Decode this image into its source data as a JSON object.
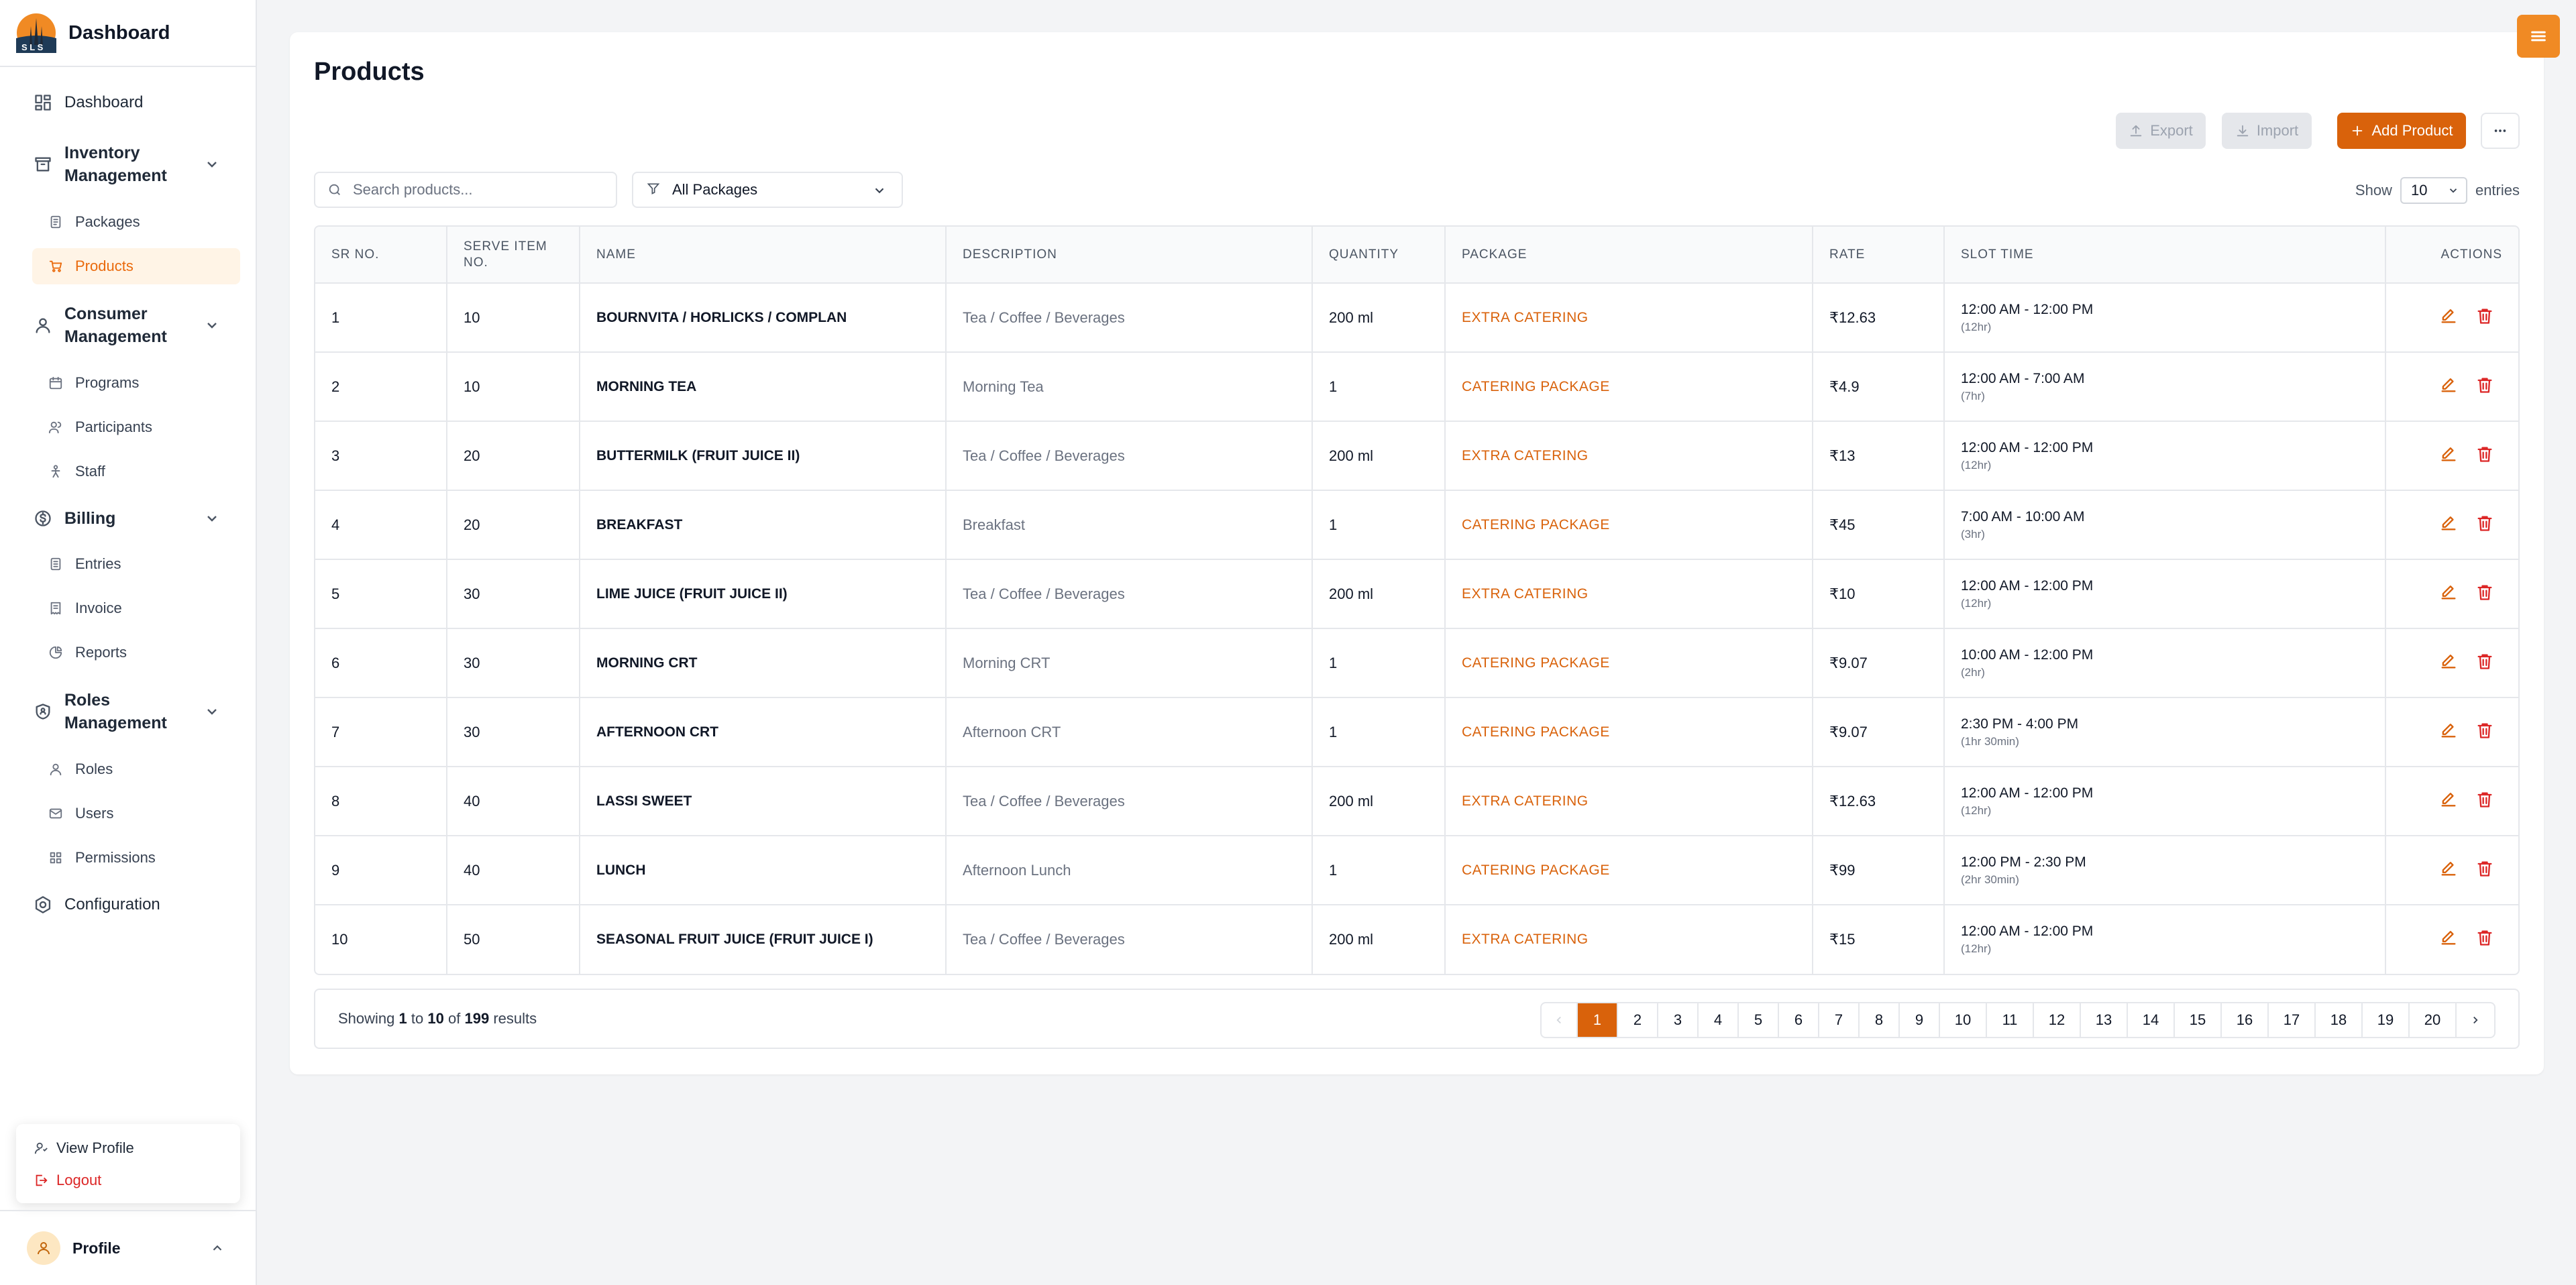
{
  "brand": {
    "title": "Dashboard",
    "logo": "sls-logo"
  },
  "sidebar": {
    "items": [
      {
        "label": "Dashboard",
        "icon": "grid-icon"
      },
      {
        "label": "Inventory Management",
        "icon": "archive-icon"
      },
      {
        "label": "Packages",
        "icon": "document-icon"
      },
      {
        "label": "Products",
        "icon": "cart-icon"
      },
      {
        "label": "Consumer Management",
        "icon": "user-icon"
      },
      {
        "label": "Programs",
        "icon": "calendar-icon"
      },
      {
        "label": "Participants",
        "icon": "users-icon"
      },
      {
        "label": "Staff",
        "icon": "staff-icon"
      },
      {
        "label": "Billing",
        "icon": "dollar-icon"
      },
      {
        "label": "Entries",
        "icon": "file-icon"
      },
      {
        "label": "Invoice",
        "icon": "receipt-icon"
      },
      {
        "label": "Reports",
        "icon": "pie-icon"
      },
      {
        "label": "Roles Management",
        "icon": "shield-icon"
      },
      {
        "label": "Roles",
        "icon": "user-icon"
      },
      {
        "label": "Users",
        "icon": "mail-icon"
      },
      {
        "label": "Permissions",
        "icon": "grid-icon"
      },
      {
        "label": "Configuration",
        "icon": "gear-icon"
      }
    ]
  },
  "profile_menu": {
    "view_profile": "View Profile",
    "logout": "Logout"
  },
  "profile": {
    "label": "Profile"
  },
  "page": {
    "title": "Products"
  },
  "toolbar": {
    "export": "Export",
    "import": "Import",
    "add": "Add Product"
  },
  "search": {
    "placeholder": "Search products..."
  },
  "filter": {
    "selected": "All Packages"
  },
  "entries": {
    "show": "Show",
    "value": "10",
    "suffix": "entries"
  },
  "table": {
    "headers": [
      "SR NO.",
      "SERVE ITEM NO.",
      "NAME",
      "DESCRIPTION",
      "QUANTITY",
      "PACKAGE",
      "RATE",
      "SLOT TIME",
      "ACTIONS"
    ],
    "rows": [
      {
        "sr": "1",
        "serve": "10",
        "name": "BOURNVITA / HORLICKS / COMPLAN",
        "desc": "Tea / Coffee / Beverages",
        "qty": "200 ml",
        "pkg": "EXTRA CATERING",
        "rate": "₹12.63",
        "slot": "12:00 AM - 12:00 PM",
        "dur": "(12hr)"
      },
      {
        "sr": "2",
        "serve": "10",
        "name": "MORNING TEA",
        "desc": "Morning Tea",
        "qty": "1",
        "pkg": "CATERING PACKAGE",
        "rate": "₹4.9",
        "slot": "12:00 AM - 7:00 AM",
        "dur": "(7hr)"
      },
      {
        "sr": "3",
        "serve": "20",
        "name": "BUTTERMILK (FRUIT JUICE II)",
        "desc": "Tea / Coffee / Beverages",
        "qty": "200 ml",
        "pkg": "EXTRA CATERING",
        "rate": "₹13",
        "slot": "12:00 AM - 12:00 PM",
        "dur": "(12hr)"
      },
      {
        "sr": "4",
        "serve": "20",
        "name": "BREAKFAST",
        "desc": "Breakfast",
        "qty": "1",
        "pkg": "CATERING PACKAGE",
        "rate": "₹45",
        "slot": "7:00 AM - 10:00 AM",
        "dur": "(3hr)"
      },
      {
        "sr": "5",
        "serve": "30",
        "name": "LIME JUICE (FRUIT JUICE II)",
        "desc": "Tea / Coffee / Beverages",
        "qty": "200 ml",
        "pkg": "EXTRA CATERING",
        "rate": "₹10",
        "slot": "12:00 AM - 12:00 PM",
        "dur": "(12hr)"
      },
      {
        "sr": "6",
        "serve": "30",
        "name": "MORNING CRT",
        "desc": "Morning CRT",
        "qty": "1",
        "pkg": "CATERING PACKAGE",
        "rate": "₹9.07",
        "slot": "10:00 AM - 12:00 PM",
        "dur": "(2hr)"
      },
      {
        "sr": "7",
        "serve": "30",
        "name": "AFTERNOON CRT",
        "desc": "Afternoon CRT",
        "qty": "1",
        "pkg": "CATERING PACKAGE",
        "rate": "₹9.07",
        "slot": "2:30 PM - 4:00 PM",
        "dur": "(1hr 30min)"
      },
      {
        "sr": "8",
        "serve": "40",
        "name": "LASSI SWEET",
        "desc": "Tea / Coffee / Beverages",
        "qty": "200 ml",
        "pkg": "EXTRA CATERING",
        "rate": "₹12.63",
        "slot": "12:00 AM - 12:00 PM",
        "dur": "(12hr)"
      },
      {
        "sr": "9",
        "serve": "40",
        "name": "LUNCH",
        "desc": "Afternoon Lunch",
        "qty": "1",
        "pkg": "CATERING PACKAGE",
        "rate": "₹99",
        "slot": "12:00 PM - 2:30 PM",
        "dur": "(2hr 30min)"
      },
      {
        "sr": "10",
        "serve": "50",
        "name": "SEASONAL FRUIT JUICE (FRUIT JUICE I)",
        "desc": "Tea / Coffee / Beverages",
        "qty": "200 ml",
        "pkg": "EXTRA CATERING",
        "rate": "₹15",
        "slot": "12:00 AM - 12:00 PM",
        "dur": "(12hr)"
      }
    ]
  },
  "pagination": {
    "showing": "Showing",
    "from": "1",
    "to_word": "to",
    "to": "10",
    "of_word": "of",
    "total": "199",
    "results_word": "results",
    "pages": [
      "1",
      "2",
      "3",
      "4",
      "5",
      "6",
      "7",
      "8",
      "9",
      "10",
      "11",
      "12",
      "13",
      "14",
      "15",
      "16",
      "17",
      "18",
      "19",
      "20"
    ],
    "current": "1"
  },
  "colors": {
    "accent": "#d9620b",
    "danger": "#dc2626",
    "active_bg": "#fff4e6"
  }
}
